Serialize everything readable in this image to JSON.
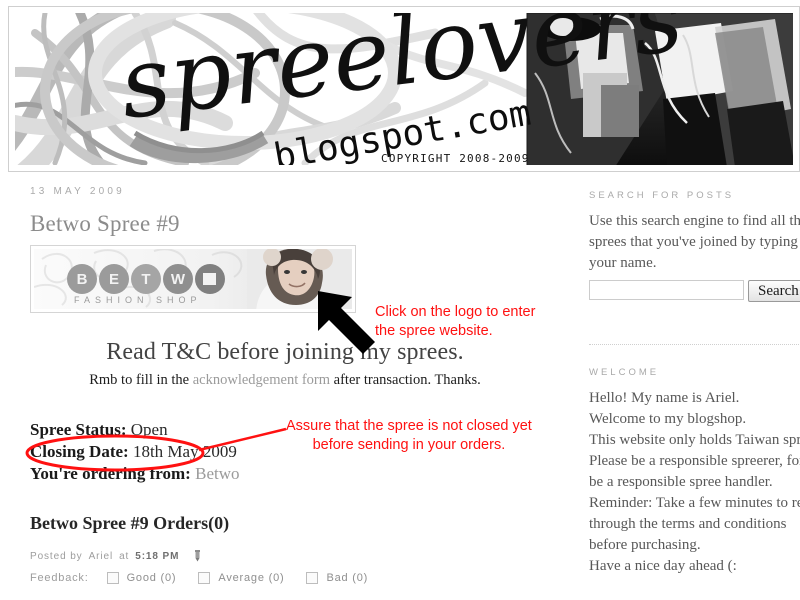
{
  "header": {
    "site_title": "spreelovers",
    "site_domain": ".blogspot.com",
    "copyright": "COPYRIGHT 2008-2009"
  },
  "post": {
    "date": "13 MAY 2009",
    "title": "Betwo Spree #9",
    "logo_brand": "BETWO",
    "logo_tagline": "FASHION SHOP",
    "tc_heading": "Read T&C before joining my sprees.",
    "tc_sub_before": "Rmb to fill in the ",
    "tc_sub_link": "acknowledgement form",
    "tc_sub_after": " after transaction. Thanks.",
    "status_label": "Spree Status:",
    "status_value": "Open",
    "closing_label": "Closing Date:",
    "closing_value": "18th May 2009",
    "ordering_label": "You're ordering from:",
    "ordering_value": "Betwo",
    "orders_heading": "Betwo Spree #9 Orders(0)",
    "posted_prefix": "Posted by",
    "posted_author": "Ariel",
    "posted_at_word": "at",
    "posted_time": "5:18 PM",
    "edit_icon": "pencil-icon",
    "feedback_label": "Feedback:",
    "feedback_options": [
      {
        "label": "Good (0)"
      },
      {
        "label": "Average (0)"
      },
      {
        "label": "Bad (0)"
      }
    ]
  },
  "sidebar": {
    "search": {
      "heading": "SEARCH FOR POSTS",
      "body_lines": [
        "Use this search engine to find all the",
        "sprees that you've joined by typing",
        "your name."
      ],
      "input_value": "",
      "input_placeholder": "",
      "button_label": "Search"
    },
    "welcome": {
      "heading": "WELCOME",
      "body_lines": [
        "Hello! My name is Ariel.",
        "Welcome to my blogshop.",
        "This website only holds Taiwan sprees.",
        "Please be a responsible spreerer, for I will",
        "be a responsible spree handler.",
        "Reminder: Take a few minutes to read",
        "through the terms and conditions",
        "before purchasing.",
        "Have a nice day ahead (:"
      ]
    }
  },
  "annotations": {
    "accent_color": "#ff1111",
    "logo_note": "Click on the logo to enter\nthe spree website.",
    "status_note": "Assure that the spree is not closed yet\nbefore sending in your orders.",
    "arrow_icon": "black-arrow-up-left-icon",
    "ellipse_icon": "red-ellipse-highlight"
  }
}
